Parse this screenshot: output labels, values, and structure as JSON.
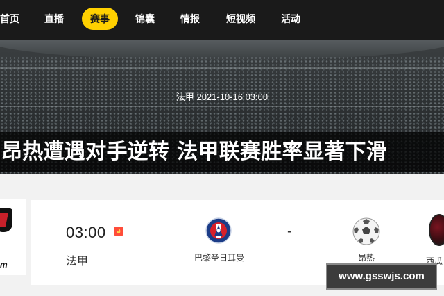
{
  "nav": {
    "items": [
      {
        "label": "首页"
      },
      {
        "label": "直播"
      },
      {
        "label": "赛事"
      },
      {
        "label": "锦囊"
      },
      {
        "label": "情报"
      },
      {
        "label": "短视频"
      },
      {
        "label": "活动"
      }
    ],
    "active_label": "赛事",
    "active_color": "#ffd000"
  },
  "banner": {
    "match_info": "法甲 2021-10-16 03:00"
  },
  "headline": "昂热遭遇对手逆转 法甲联赛胜率显著下滑",
  "left_card": {
    "partial_text": "m"
  },
  "match": {
    "time": "03:00",
    "league": "法甲",
    "home_team": "巴黎圣日耳曼",
    "vs": "-",
    "away_team": "昂热",
    "hot_icon": "fire-badge-icon",
    "home_logo_icon": "psg-logo-icon",
    "away_logo_icon": "soccer-ball-icon"
  },
  "right_card": {
    "partial_name": "西瓜"
  },
  "watermark": "www.gsswjs.com"
}
